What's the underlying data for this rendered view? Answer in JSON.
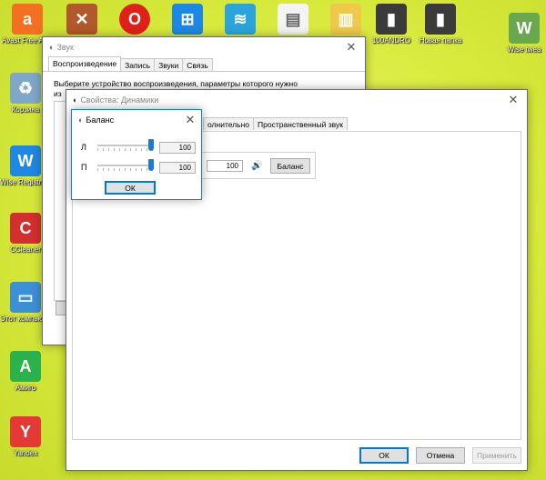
{
  "desktop": {
    "icons": [
      {
        "label": "Avast Free Antivirus",
        "glyph": "a",
        "color": "#f36f21"
      },
      {
        "label": "Корзина",
        "glyph": "♻",
        "color": "#7fa7c9"
      },
      {
        "label": "Wise Registry Cleaner",
        "glyph": "W",
        "color": "#1e88e5"
      },
      {
        "label": "CCleaner",
        "glyph": "C",
        "color": "#d32f2f"
      },
      {
        "label": "Этот компьютер",
        "glyph": "▭",
        "color": "#3d8fd6"
      },
      {
        "label": "Амиго",
        "glyph": "A",
        "color": "#2bb24c"
      },
      {
        "label": "Yandex",
        "glyph": "Y",
        "color": "#e53935"
      },
      {
        "label": "100ANDRO",
        "glyph": "▮",
        "color": "#3b3b3b"
      },
      {
        "label": "Новая папка",
        "glyph": "▮",
        "color": "#3b3b3b"
      },
      {
        "label": "Wise twea",
        "glyph": "W",
        "color": "#6aa84f"
      }
    ]
  },
  "sound_window": {
    "title": "Звук",
    "tabs": [
      "Воспроизведение",
      "Запись",
      "Звуки",
      "Связь"
    ],
    "instruction_line1": "Выберите устройство воспроизведения, параметры которого нужно",
    "instruction_line2": "из"
  },
  "properties_window": {
    "title": "Свойства: Динамики",
    "tabs": [
      "олнительно",
      "Пространственный звук"
    ],
    "level_value": "100",
    "balance_button": "Баланс",
    "ok": "ОК",
    "cancel": "Отмена",
    "apply": "Применить"
  },
  "balance_dialog": {
    "title": "Баланс",
    "left_label": "Л",
    "right_label": "П",
    "left_value": "100",
    "right_value": "100",
    "ok": "ОК"
  }
}
